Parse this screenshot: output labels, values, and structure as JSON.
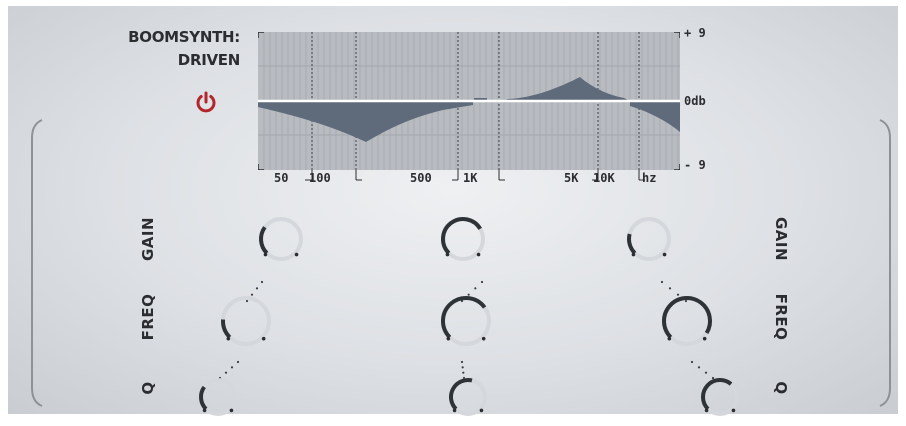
{
  "header": {
    "title_line1": "BOOMSYNTH:",
    "title_line2": "DRIVEN"
  },
  "power": {
    "icon": "power-icon",
    "color": "#b3262b"
  },
  "graph": {
    "y_max_label": "+ 9",
    "y_mid_label": "0db",
    "y_min_label": "- 9",
    "x_labels": [
      "50",
      "100",
      "500",
      "1K",
      "5K",
      "10K",
      "hz"
    ],
    "fill_color": "#5f6b7a",
    "bg_color": "#b8bcc1"
  },
  "controls": {
    "left_labels": {
      "gain": "GAIN",
      "freq": "FREQ",
      "q": "Q"
    },
    "right_labels": {
      "gain": "GAIN",
      "freq": "FREQ",
      "q": "Q"
    }
  },
  "knobs": [
    {
      "id": "band1-gain",
      "value": 0.3
    },
    {
      "id": "band2-gain",
      "value": 0.72
    },
    {
      "id": "band3-gain",
      "value": 0.22
    },
    {
      "id": "band1-freq",
      "value": 0.18
    },
    {
      "id": "band2-freq",
      "value": 0.7
    },
    {
      "id": "band3-freq",
      "value": 0.95
    },
    {
      "id": "band1-q",
      "value": 0.3
    },
    {
      "id": "band2-q",
      "value": 0.55
    },
    {
      "id": "band3-q",
      "value": 0.65
    }
  ],
  "accent": "#2e3338"
}
